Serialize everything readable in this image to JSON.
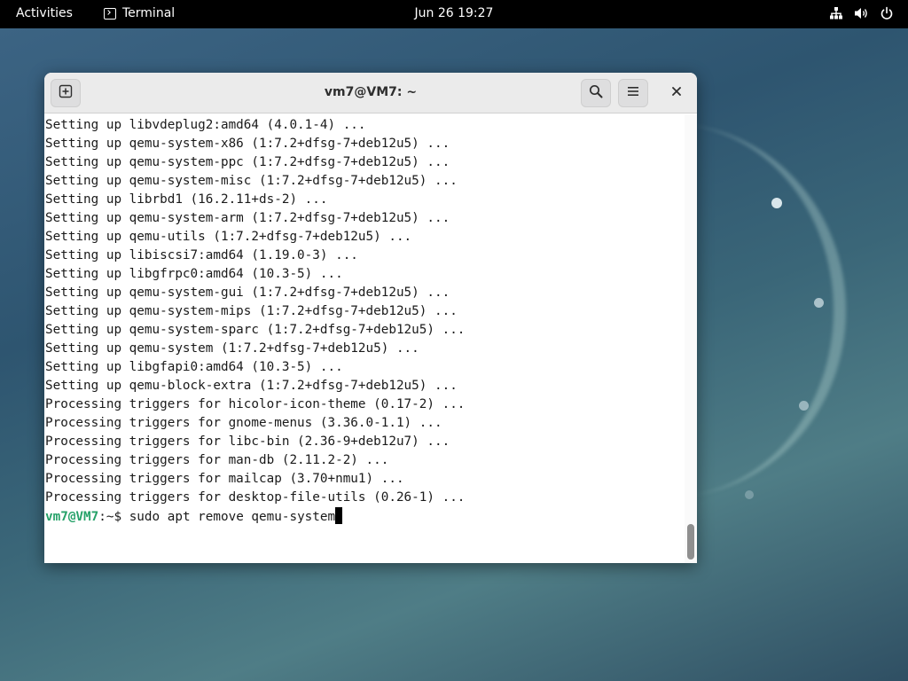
{
  "top_bar": {
    "activities_label": "Activities",
    "app_name": "Terminal",
    "app_icon": "terminal-icon",
    "clock": "Jun 26  19:27",
    "tray_icons": [
      "network-wired-icon",
      "volume-icon",
      "power-icon"
    ]
  },
  "window": {
    "title": "vm7@VM7: ~",
    "buttons": {
      "new_tab_icon": "new-tab-icon",
      "search_icon": "search-icon",
      "menu_icon": "hamburger-menu-icon",
      "close_icon": "close-icon"
    }
  },
  "terminal": {
    "lines": [
      "Setting up libvdeplug2:amd64 (4.0.1-4) ...",
      "Setting up qemu-system-x86 (1:7.2+dfsg-7+deb12u5) ...",
      "Setting up qemu-system-ppc (1:7.2+dfsg-7+deb12u5) ...",
      "Setting up qemu-system-misc (1:7.2+dfsg-7+deb12u5) ...",
      "Setting up librbd1 (16.2.11+ds-2) ...",
      "Setting up qemu-system-arm (1:7.2+dfsg-7+deb12u5) ...",
      "Setting up qemu-utils (1:7.2+dfsg-7+deb12u5) ...",
      "Setting up libiscsi7:amd64 (1.19.0-3) ...",
      "Setting up libgfrpc0:amd64 (10.3-5) ...",
      "Setting up qemu-system-gui (1:7.2+dfsg-7+deb12u5) ...",
      "Setting up qemu-system-mips (1:7.2+dfsg-7+deb12u5) ...",
      "Setting up qemu-system-sparc (1:7.2+dfsg-7+deb12u5) ...",
      "Setting up qemu-system (1:7.2+dfsg-7+deb12u5) ...",
      "Setting up libgfapi0:amd64 (10.3-5) ...",
      "Setting up qemu-block-extra (1:7.2+dfsg-7+deb12u5) ...",
      "Processing triggers for hicolor-icon-theme (0.17-2) ...",
      "Processing triggers for gnome-menus (3.36.0-1.1) ...",
      "Processing triggers for libc-bin (2.36-9+deb12u7) ...",
      "Processing triggers for man-db (2.11.2-2) ...",
      "Processing triggers for mailcap (3.70+nmu1) ...",
      "Processing triggers for desktop-file-utils (0.26-1) ..."
    ],
    "prompt": {
      "user_host": "vm7@VM7",
      "path_symbol": ":~$ ",
      "command": "sudo apt remove qemu-system"
    }
  },
  "colors": {
    "prompt_user": "#26a269",
    "top_bar_bg": "#000000",
    "headerbar_bg": "#ebebeb"
  }
}
